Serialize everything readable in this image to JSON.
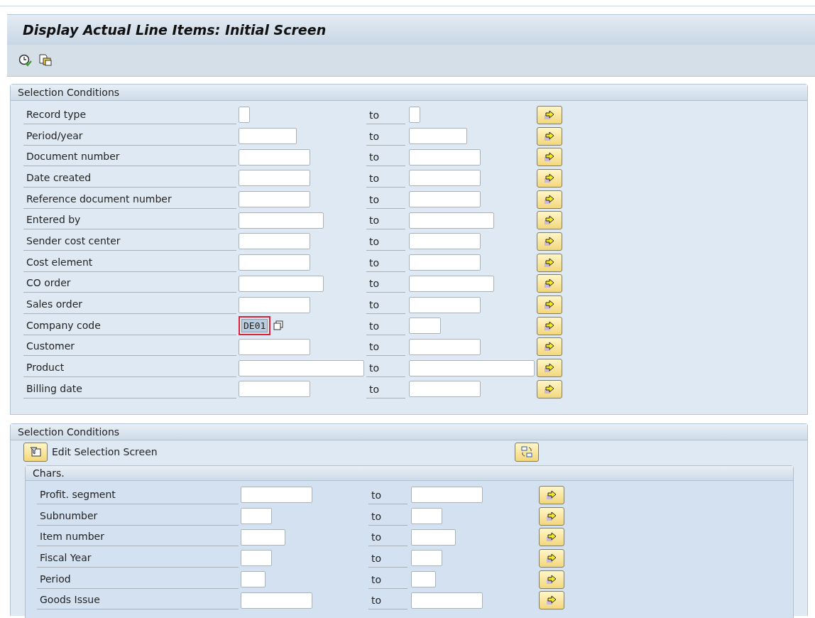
{
  "window": {
    "title": "Display Actual Line Items: Initial Screen"
  },
  "toolbar": [
    {
      "kind": "execute"
    },
    {
      "kind": "variant"
    }
  ],
  "sections": [
    {
      "title": "Selection Conditions",
      "rows": [
        {
          "label": "Record type",
          "to_label": "to"
        },
        {
          "label": "Period/year",
          "to_label": "to"
        },
        {
          "label": "Document number",
          "to_label": "to"
        },
        {
          "label": "Date created",
          "to_label": "to"
        },
        {
          "label": "Reference document number",
          "to_label": "to"
        },
        {
          "label": "Entered by",
          "to_label": "to"
        },
        {
          "label": "Sender cost center",
          "to_label": "to"
        },
        {
          "label": "Cost element",
          "to_label": "to"
        },
        {
          "label": "CO order",
          "to_label": "to"
        },
        {
          "label": "Sales order",
          "to_label": "to"
        },
        {
          "label": "Company code",
          "to_label": "to",
          "value": "DE01",
          "focused": true
        },
        {
          "label": "Customer",
          "to_label": "to"
        },
        {
          "label": "Product",
          "to_label": "to"
        },
        {
          "label": "Billing date",
          "to_label": "to"
        }
      ]
    },
    {
      "title": "Selection Conditions",
      "edit_button": "Edit Selection Screen",
      "subsection": {
        "title": "Chars.",
        "rows": [
          {
            "label": "Profit. segment",
            "to_label": "to"
          },
          {
            "label": "Subnumber",
            "to_label": "to"
          },
          {
            "label": "Item number",
            "to_label": "to"
          },
          {
            "label": "Fiscal Year",
            "to_label": "to"
          },
          {
            "label": "Period",
            "to_label": "to"
          },
          {
            "label": "Goods Issue",
            "to_label": "to"
          }
        ]
      }
    }
  ]
}
